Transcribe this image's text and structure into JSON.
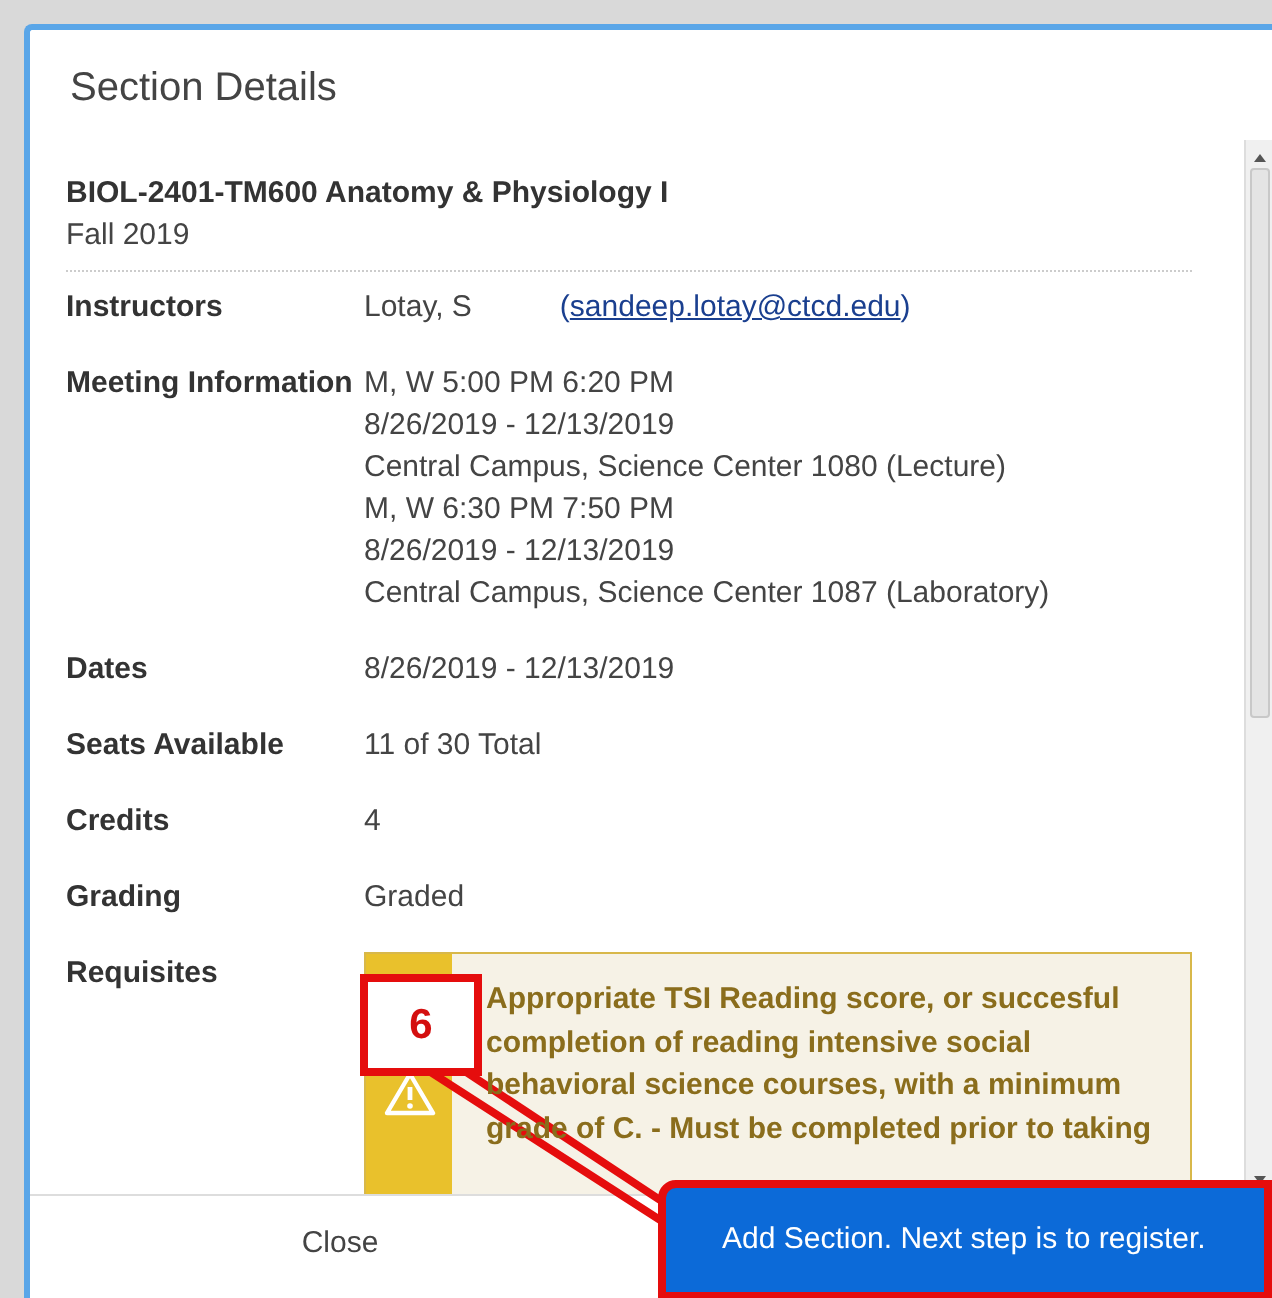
{
  "modal": {
    "title": "Section Details"
  },
  "course": {
    "title": "BIOL-2401-TM600 Anatomy & Physiology I",
    "term": "Fall 2019"
  },
  "details": [
    {
      "label": "Instructors",
      "kind": "instructor",
      "name": "Lotay, S",
      "email": "(sandeep.lotay@ctcd.edu)"
    },
    {
      "label": "Meeting Information",
      "kind": "lines",
      "lines": [
        "M, W 5:00 PM 6:20 PM",
        "8/26/2019 - 12/13/2019",
        "Central Campus, Science Center 1080 (Lecture)",
        "M, W 6:30 PM 7:50 PM",
        "8/26/2019 - 12/13/2019",
        "Central Campus, Science Center 1087 (Laboratory)"
      ]
    },
    {
      "label": "Dates",
      "kind": "lines",
      "lines": [
        "8/26/2019 - 12/13/2019"
      ]
    },
    {
      "label": "Seats Available",
      "kind": "lines",
      "lines": [
        "11 of 30 Total"
      ]
    },
    {
      "label": "Credits",
      "kind": "lines",
      "lines": [
        "4"
      ]
    },
    {
      "label": "Grading",
      "kind": "lines",
      "lines": [
        "Graded"
      ]
    },
    {
      "label": "Requisites",
      "kind": "warning",
      "text": "Appropriate TSI Reading score, or succesful completion of reading intensive social behavioral science courses, with a minimum grade of C. - Must be completed prior to taking"
    }
  ],
  "footer": {
    "close": "Close",
    "add": "Add Section. Next step is to register."
  },
  "annotation": {
    "label": "6"
  }
}
